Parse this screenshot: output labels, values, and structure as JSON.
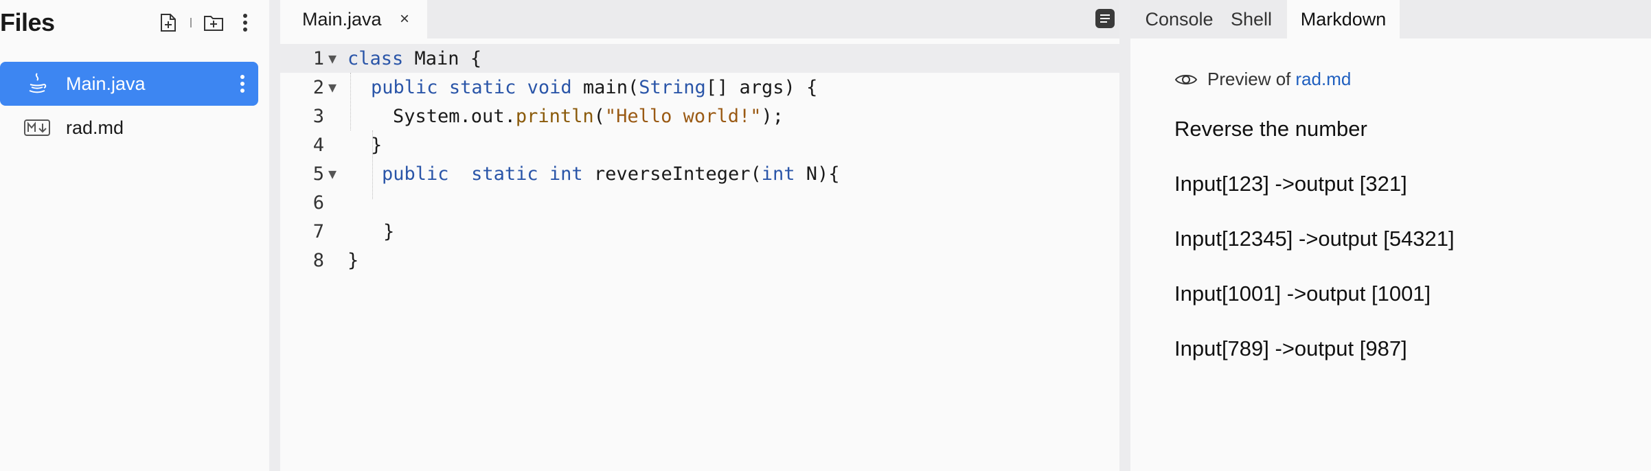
{
  "sidebar": {
    "title": "Files",
    "files": [
      {
        "name": "Main.java",
        "icon": "java-icon",
        "active": true
      },
      {
        "name": "rad.md",
        "icon": "markdown-icon",
        "active": false
      }
    ]
  },
  "editor": {
    "tab_label": "Main.java",
    "tab_close": "×",
    "lines": [
      {
        "n": "1"
      },
      {
        "n": "2"
      },
      {
        "n": "3"
      },
      {
        "n": "4"
      },
      {
        "n": "5"
      },
      {
        "n": "6"
      },
      {
        "n": "7"
      },
      {
        "n": "8"
      }
    ],
    "code": {
      "l1_kw": "class",
      "l1_rest": " Main {",
      "l2_kw1": "public",
      "l2_kw2": "static",
      "l2_kw3": "void",
      "l2_fn": "main",
      "l2_p1": "(",
      "l2_ty": "String",
      "l2_rest": "[] args) {",
      "l3_a": "System",
      "l3_b": ".out.",
      "l3_fn": "println",
      "l3_p1": "(",
      "l3_str": "\"Hello world!\"",
      "l3_end": ");",
      "l4": "}",
      "l5_kw1": "public",
      "l5_kw2": "static",
      "l5_kw3": "int",
      "l5_fn": "reverseInteger(",
      "l5_kw4": "int",
      "l5_rest": " N){",
      "l7": "}",
      "l8": "}"
    }
  },
  "right": {
    "tabs": [
      "Console",
      "Shell",
      "Markdown"
    ],
    "active_tab": "Markdown",
    "preview_prefix": "Preview of",
    "preview_file": "rad.md",
    "paragraphs": [
      "Reverse the number",
      "Input[123] ->output [321]",
      "Input[12345] ->output [54321]",
      "Input[1001] ->output [1001]",
      "Input[789] ->output [987]"
    ]
  },
  "colors": {
    "accent": "#3d86f2",
    "keyword": "#2a55a8",
    "string": "#9a5a14",
    "link": "#1f5fbf"
  }
}
